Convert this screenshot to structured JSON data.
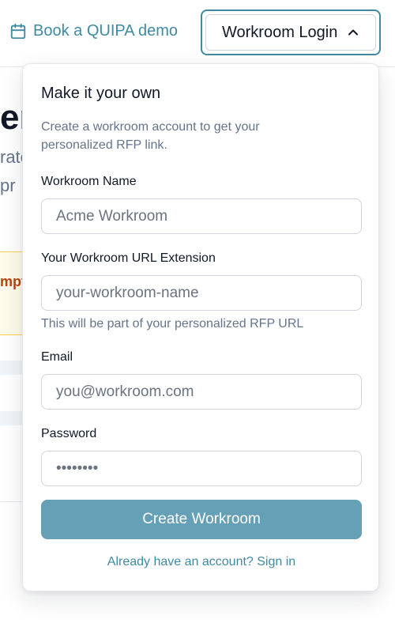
{
  "header": {
    "demo_link": "Book a QUIPA demo",
    "login_button": "Workroom Login"
  },
  "background": {
    "heading_fragment": "er!",
    "text_fragment_1": "rate",
    "text_fragment_2": "pr",
    "banner_fragment": "mpt"
  },
  "form": {
    "title": "Make it your own",
    "subtitle": "Create a workroom account to get your personalized RFP link.",
    "workroom_name": {
      "label": "Workroom Name",
      "placeholder": "Acme Workroom",
      "value": ""
    },
    "url_extension": {
      "label": "Your Workroom URL Extension",
      "placeholder": "your-workroom-name",
      "value": "",
      "help": "This will be part of your personalized RFP URL"
    },
    "email": {
      "label": "Email",
      "placeholder": "you@workroom.com",
      "value": ""
    },
    "password": {
      "label": "Password",
      "placeholder": "••••••••",
      "value": ""
    },
    "submit_label": "Create Workroom",
    "signin_link": "Already have an account? Sign in"
  },
  "colors": {
    "accent": "#3f8aa3",
    "button": "#66a0b7",
    "muted_text": "#64748b"
  }
}
